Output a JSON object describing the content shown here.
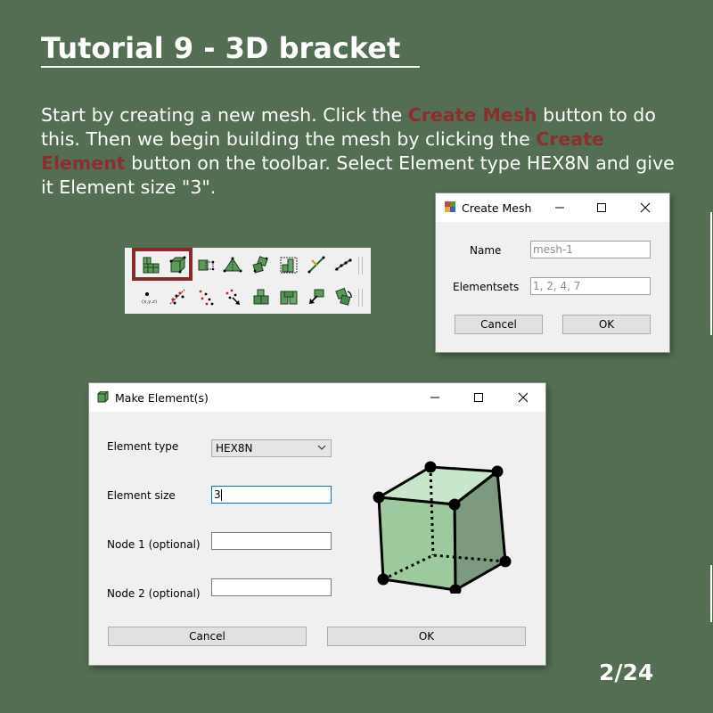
{
  "slide": {
    "title": "Tutorial 9 - 3D bracket",
    "intro": {
      "p1": "Start by creating a new mesh. Click the ",
      "h1": "Create Mesh",
      "p2": " button to do this. Then we begin building the mesh by clicking the ",
      "h2": "Create Element",
      "p3": " button on the toolbar. Select Element type HEX8N and give it Element size \"3\"."
    },
    "page_number": "2/24",
    "highlight_color": "#8b2e2e",
    "background_color": "#546e53"
  },
  "toolbar": {
    "row1_icons": [
      "create-mesh-icon",
      "create-element-icon",
      "element-grid-icon",
      "triangle-element-icon",
      "node-cluster-icon",
      "element-selection-icon",
      "line-tool-icon",
      "node-line-icon"
    ],
    "row2_icons": [
      "node-coordinate-icon",
      "node-set-icon",
      "point-cloud-icon",
      "node-arrow-icon",
      "element-block-icon",
      "element-group-icon",
      "move-element-icon",
      "rotate-element-icon"
    ],
    "node_coordinate_label": "(x,y,z)"
  },
  "create_mesh_dialog": {
    "title": "Create Mesh",
    "name_label": "Name",
    "name_placeholder": "mesh-1",
    "elementsets_label": "Elementsets",
    "elementsets_placeholder": "1, 2, 4, 7",
    "cancel_label": "Cancel",
    "ok_label": "OK"
  },
  "make_element_dialog": {
    "title": "Make Element(s)",
    "element_type_label": "Element type",
    "element_type_value": "HEX8N",
    "element_size_label": "Element size",
    "element_size_value": "3",
    "node1_label": "Node 1 (optional)",
    "node1_value": "",
    "node2_label": "Node 2 (optional)",
    "node2_value": "",
    "cancel_label": "Cancel",
    "ok_label": "OK",
    "preview_icon": "hex8n-cube-icon",
    "preview_colors": {
      "front": "#9ecb9e",
      "side": "#7d9a80",
      "top": "#c8e6cc"
    }
  }
}
